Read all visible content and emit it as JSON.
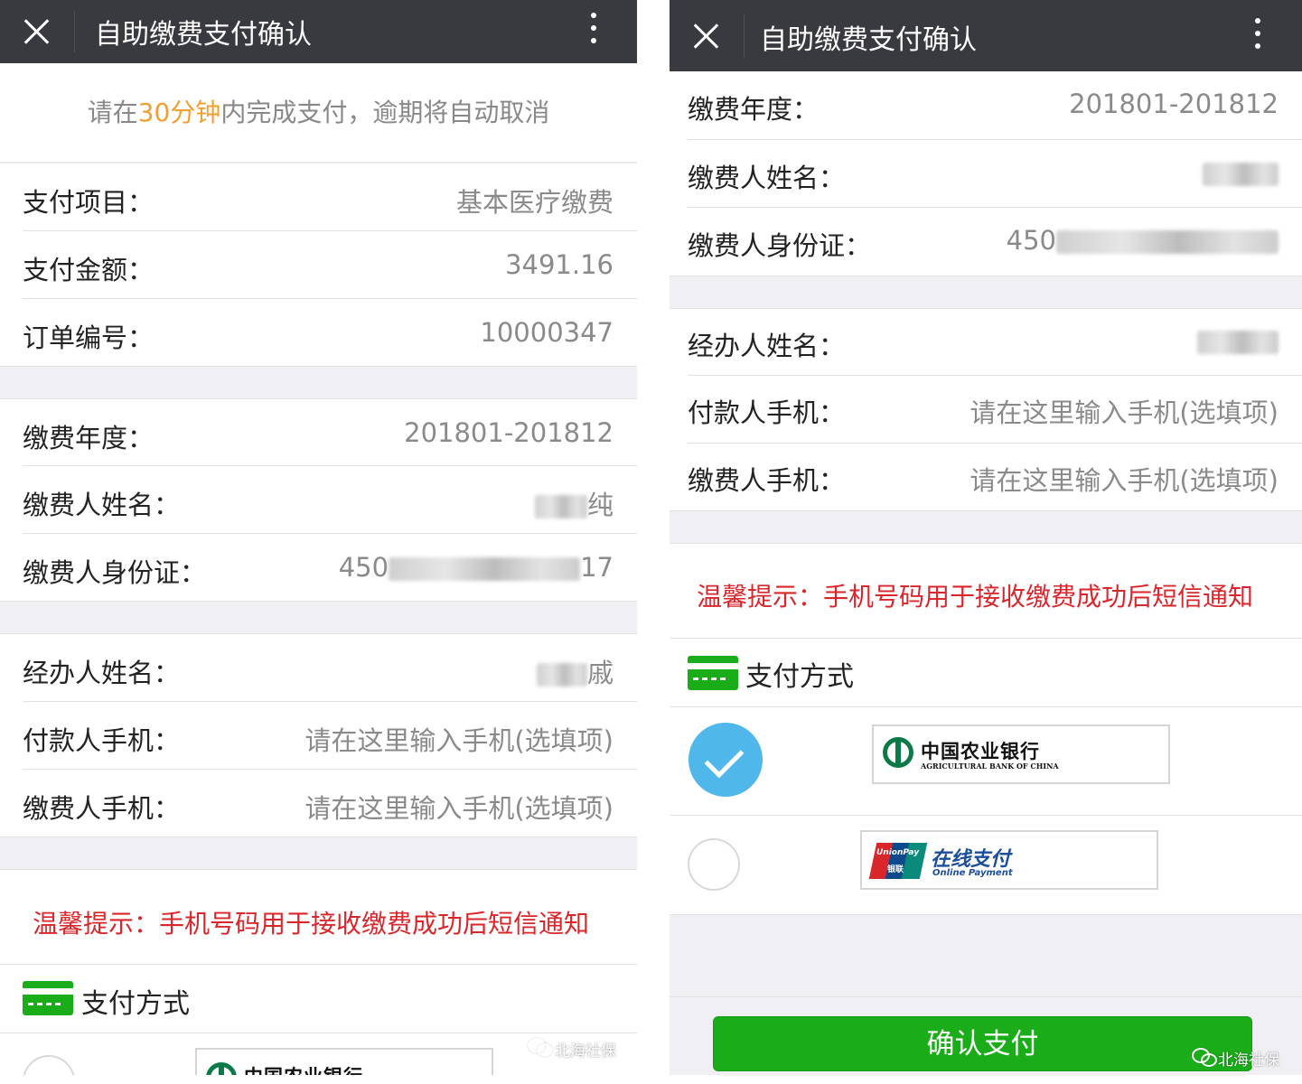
{
  "left_screen": {
    "title": "自助缴费支付确认",
    "notice": {
      "prefix": "请在",
      "highlight": "30分钟",
      "suffix": "内完成支付，逾期将自动取消"
    },
    "rows": [
      {
        "label": "支付项目：",
        "value": "基本医疗缴费"
      },
      {
        "label": "支付金额：",
        "value": "3491.16"
      },
      {
        "label": "订单编号：",
        "value": "10000347"
      },
      {
        "label": "缴费年度：",
        "value": "201801-201812"
      },
      {
        "label": "缴费人姓名：",
        "value": "纯"
      },
      {
        "label": "缴费人身份证：",
        "value_prefix": "450",
        "value_suffix": "17"
      },
      {
        "label": "经办人姓名：",
        "value": "戚"
      },
      {
        "label": "付款人手机：",
        "placeholder": "请在这里输入手机(选填项)"
      },
      {
        "label": "缴费人手机：",
        "placeholder": "请在这里输入手机(选填项)"
      }
    ],
    "tip": "温馨提示：手机号码用于接收缴费成功后短信通知",
    "payment_method_title": "支付方式",
    "partial_bank_text": "中国农业银行",
    "watermark": "北海社保"
  },
  "right_screen": {
    "title": "自助缴费支付确认",
    "rows": [
      {
        "label": "缴费年度：",
        "value": "201801-201812"
      },
      {
        "label": "缴费人姓名：",
        "value": ""
      },
      {
        "label": "缴费人身份证：",
        "value_prefix": "450"
      },
      {
        "label": "经办人姓名：",
        "value": ""
      },
      {
        "label": "付款人手机：",
        "placeholder": "请在这里输入手机(选填项)"
      },
      {
        "label": "缴费人手机：",
        "placeholder": "请在这里输入手机(选填项)"
      }
    ],
    "tip": "温馨提示：手机号码用于接收缴费成功后短信通知",
    "payment_method_title": "支付方式",
    "banks": [
      {
        "name": "中国农业银行",
        "sub": "AGRICULTURAL BANK OF CHINA",
        "selected": true
      },
      {
        "name": "在线支付",
        "sub": "Online Payment",
        "brand_top": "UnionPay",
        "brand_bottom": "银联",
        "selected": false
      }
    ],
    "confirm_button": "确认支付",
    "watermark": "北海社保"
  },
  "colors": {
    "titlebar": "#393a3f",
    "accent_green": "#1aad19",
    "highlight_orange": "#f0a030",
    "tip_red": "#d9262b",
    "radio_blue": "#4fb7ea"
  },
  "icons": [
    "close-icon",
    "more-icon",
    "card-icon",
    "check-icon",
    "wechat-icon"
  ]
}
